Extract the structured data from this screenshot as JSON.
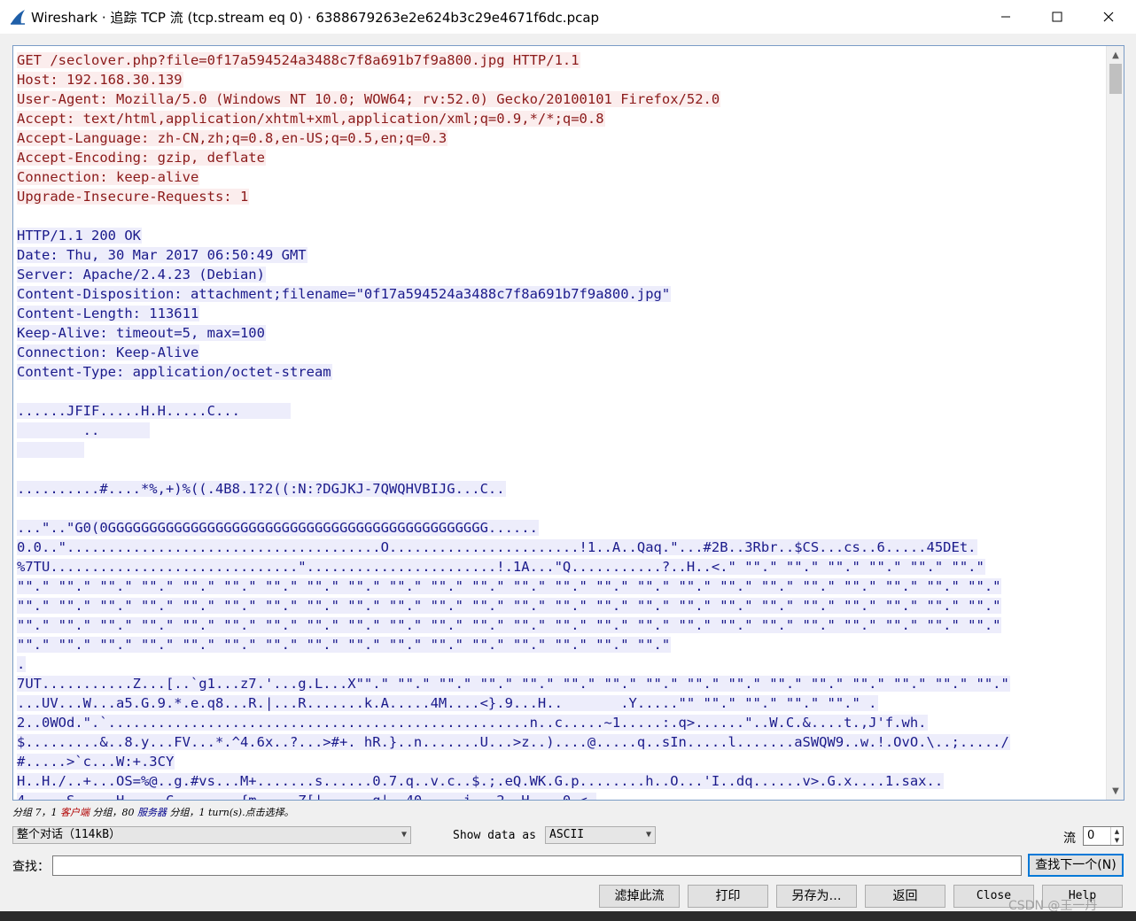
{
  "window": {
    "title": "Wireshark · 追踪 TCP 流 (tcp.stream eq 0) · 6388679263e2e624b3c29e4671f6dc.pcap",
    "minimize_glyph": "—",
    "maximize_glyph": "☐",
    "close_glyph": "✕"
  },
  "stream": {
    "client_lines": [
      "GET /seclover.php?file=0f17a594524a3488c7f8a691b7f9a800.jpg HTTP/1.1",
      "Host: 192.168.30.139",
      "User-Agent: Mozilla/5.0 (Windows NT 10.0; WOW64; rv:52.0) Gecko/20100101 Firefox/52.0",
      "Accept: text/html,application/xhtml+xml,application/xml;q=0.9,*/*;q=0.8",
      "Accept-Language: zh-CN,zh;q=0.8,en-US;q=0.5,en;q=0.3",
      "Accept-Encoding: gzip, deflate",
      "Connection: keep-alive",
      "Upgrade-Insecure-Requests: 1"
    ],
    "server_header_lines": [
      "HTTP/1.1 200 OK",
      "Date: Thu, 30 Mar 2017 06:50:49 GMT",
      "Server: Apache/2.4.23 (Debian)",
      "Content-Disposition: attachment;filename=\"0f17a594524a3488c7f8a691b7f9a800.jpg\"",
      "Content-Length: 113611",
      "Keep-Alive: timeout=5, max=100",
      "Connection: Keep-Alive",
      "Content-Type: application/octet-stream"
    ],
    "jfif_block": [
      "......JFIF.....H.H.....C...      ",
      "        ..      ",
      "        "
    ],
    "line_quant": "..........#....*%,+)%((.4B8.1?2((:N:?DGJKJ-7QWQHVBIJG...C..",
    "binary_lines": [
      "...\"..\"G0(0GGGGGGGGGGGGGGGGGGGGGGGGGGGGGGGGGGGGGGGGGGGGGG......",
      "0.0..\"......................................O.......................!1..A..Qaq.\"...#2B..3Rbr..$CS...cs..6.....45DEt.",
      "%7TU..............................\".......................!.1A...\"Q...........?..H..<.\" \"\".\" \"\".\" \"\".\" \"\".\" \"\".\" \"\".\"",
      "\"\".\" \"\".\" \"\".\" \"\".\" \"\".\" \"\".\" \"\".\" \"\".\" \"\".\" \"\".\" \"\".\" \"\".\" \"\".\" \"\".\" \"\".\" \"\".\" \"\".\" \"\".\" \"\".\" \"\".\" \"\".\" \"\".\" \"\".\" \"\".\"",
      "\"\".\" \"\".\" \"\".\" \"\".\" \"\".\" \"\".\" \"\".\" \"\".\" \"\".\" \"\".\" \"\".\" \"\".\" \"\".\" \"\".\" \"\".\" \"\".\" \"\".\" \"\".\" \"\".\" \"\".\" \"\".\" \"\".\" \"\".\" \"\".\"",
      "\"\".\" \"\".\" \"\".\" \"\".\" \"\".\" \"\".\" \"\".\" \"\".\" \"\".\" \"\".\" \"\".\" \"\".\" \"\".\" \"\".\" \"\".\" \"\".\" \"\".\" \"\".\" \"\".\" \"\".\" \"\".\" \"\".\" \"\".\" \"\".\"",
      "\"\".\" \"\".\" \"\".\" \"\".\" \"\".\" \"\".\" \"\".\" \"\".\" \"\".\" \"\".\" \"\".\" \"\".\" \"\".\" \"\".\" \"\".\" \"\".\"",
      ".",
      "7UT...........Z...[..`g1...z7.'...g.L...X\"\".\" \"\".\" \"\".\" \"\".\" \"\".\" \"\".\" \"\".\" \"\".\" \"\".\" \"\".\" \"\".\" \"\".\" \"\".\" \"\".\" \"\".\" \"\".\"",
      "...UV...W...a5.G.9.*.e.q8...R.|...R.......k.A.....4M....<}.9...H..       .Y.....\"\" \"\".\" \"\".\" \"\".\" \"\".\" .",
      "2..0WOd.\".`...................................................n..c.....~1.....:.q>......\"..W.C.&....t.,J'f.wh.",
      "$.........&..8.y...FV...*.^4.6x..?...>#+. hR.}..n.......U...>z..)....@.....q..sIn.....l.......aSWQW9..w.!.OvO.\\..;...../",
      "#.....>`c...W:+.3CY",
      "H..H./..+...OS=%@..g.#vs...M+.......s......0.7.q..v.c..$.;.eQ.WK.G.p........h..O...'I..dq......v>.G.x....1.sax..",
      "4.....S.....H.....C........{m.....Z[|......g|..40.....i...2..H....0.<."
    ]
  },
  "status": {
    "part1": "分组 7，1 ",
    "client_word": "客户端",
    "part2": " 分组，80 ",
    "server_word": "服务器",
    "part3": " 分组，1 turn(s).点击选择。"
  },
  "controls": {
    "conversation": "整个对话（114kB）",
    "show_as_label": "Show data as",
    "show_as_value": "ASCII",
    "stream_label": "流",
    "stream_value": "0",
    "find_label": "查找：",
    "find_value": "",
    "find_next": "查找下一个(N)",
    "buttons": {
      "filter": "滤掉此流",
      "print": "打印",
      "save_as": "另存为…",
      "back": "返回",
      "close": "Close",
      "help": "Help"
    }
  },
  "watermark": "CSDN @王一丹",
  "colors": {
    "client_bg": "#fbeded",
    "client_fg": "#8b1a1a",
    "server_bg": "#ededfb",
    "server_fg": "#1a1a8b"
  }
}
